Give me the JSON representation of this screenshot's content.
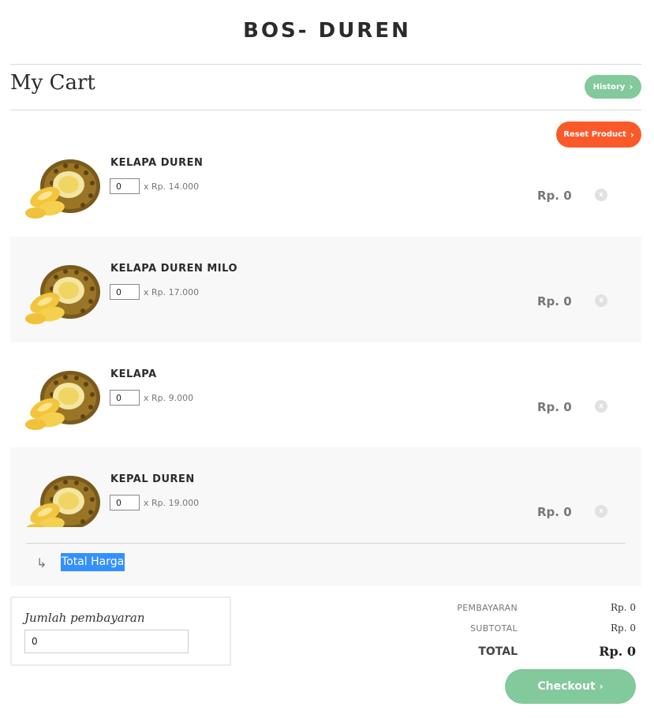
{
  "header": {
    "brand": "BOS- DUREN"
  },
  "cart": {
    "title": "My Cart",
    "history_label": "History",
    "reset_label": "Reset Product"
  },
  "products": [
    {
      "name": "KELAPA DUREN",
      "qty": "0",
      "unit_price": "x Rp. 14.000",
      "total": "Rp. 0",
      "remove": "x"
    },
    {
      "name": "KELAPA DUREN MILO",
      "qty": "0",
      "unit_price": "x Rp. 17.000",
      "total": "Rp. 0",
      "remove": "x"
    },
    {
      "name": "KELAPA",
      "qty": "0",
      "unit_price": "x Rp. 9.000",
      "total": "Rp. 0",
      "remove": "x"
    },
    {
      "name": "KEPAL DUREN",
      "qty": "0",
      "unit_price": "x Rp. 19.000",
      "total": "Rp. 0",
      "remove": "x"
    }
  ],
  "total_harga": {
    "arrow": "↳",
    "label": "Total Harga"
  },
  "payment": {
    "label": "Jumlah pembayaran",
    "value": "0"
  },
  "summary": {
    "pembayaran_label": "PEMBAYARAN",
    "pembayaran_value": "Rp. 0",
    "subtotal_label": "SUBTOTAL",
    "subtotal_value": "Rp. 0",
    "total_label": "TOTAL",
    "total_value": "Rp. 0"
  },
  "checkout_label": "Checkout",
  "icons": {
    "chevron": "chevron-right-icon",
    "remove": "close-icon",
    "image": "durian-image"
  },
  "colors": {
    "green": "#82c99b",
    "orange": "#fa5a2a",
    "highlight": "#3390ff"
  }
}
